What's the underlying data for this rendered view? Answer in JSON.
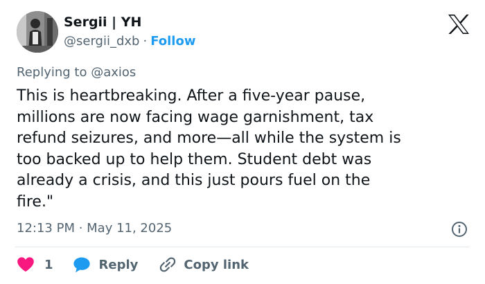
{
  "author": {
    "display_name": "Sergii | YH",
    "handle": "@sergii_dxb",
    "separator": "·",
    "follow_label": "Follow"
  },
  "brand": {
    "logo_icon": "x-logo-icon",
    "color": "#0f1419"
  },
  "reply_context": {
    "prefix": "Replying to",
    "mention": "@axios"
  },
  "tweet": {
    "text": "This is heartbreaking. After a five-year pause,\nmillions are now facing wage garnishment, tax\nrefund seizures, and more—all while the system is\ntoo backed up to help them. Student debt was\nalready a crisis, and this just pours fuel on the\nfire.\"",
    "timestamp": "12:13 PM · May 11, 2025"
  },
  "actions": {
    "like_count": "1",
    "reply_label": "Reply",
    "copy_link_label": "Copy link"
  },
  "icons": {
    "like": "heart-icon",
    "reply": "speech-bubble-icon",
    "copy": "link-icon",
    "info": "info-icon"
  },
  "colors": {
    "link": "#1d9bf0",
    "secondary_text": "#536471",
    "like": "#f91880",
    "reply": "#1d9bf0"
  }
}
